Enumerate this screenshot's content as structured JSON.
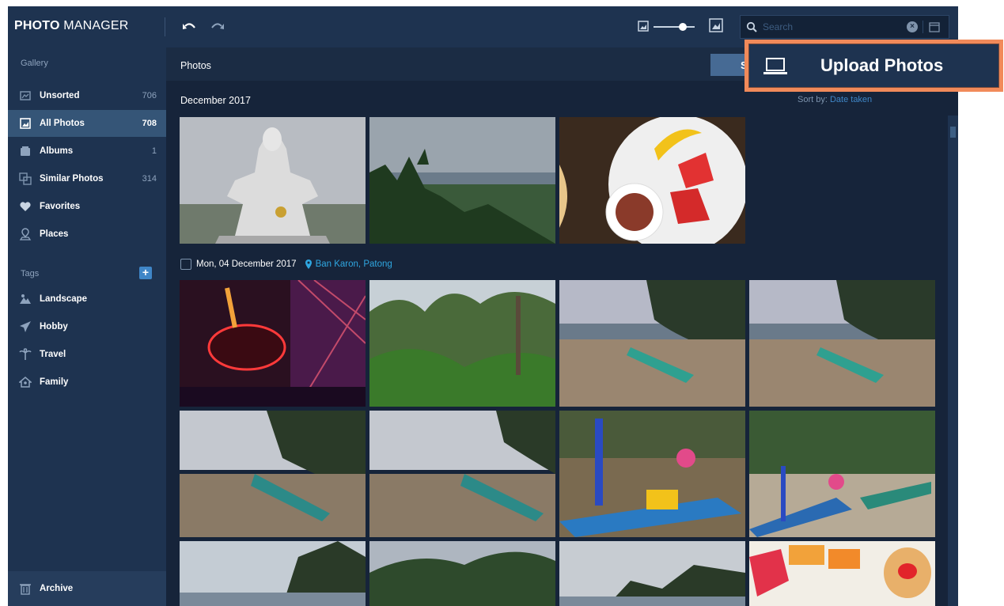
{
  "app": {
    "brand_bold": "PHOTO",
    "brand_rest": " MANAGER"
  },
  "toolbar": {
    "zoom_level": 0.75,
    "search_placeholder": "Search"
  },
  "sidebar": {
    "gallery_title": "Gallery",
    "items": [
      {
        "label": "Unsorted",
        "count": "706",
        "icon": "unsorted-icon",
        "active": false
      },
      {
        "label": "All Photos",
        "count": "708",
        "icon": "all-photos-icon",
        "active": true
      },
      {
        "label": "Albums",
        "count": "1",
        "icon": "albums-icon",
        "active": false
      },
      {
        "label": "Similar Photos",
        "count": "314",
        "icon": "similar-photos-icon",
        "active": false
      },
      {
        "label": "Favorites",
        "count": "",
        "icon": "heart-icon",
        "active": false
      },
      {
        "label": "Places",
        "count": "",
        "icon": "map-pin-icon",
        "active": false
      }
    ],
    "tags_title": "Tags",
    "tags": [
      {
        "label": "Landscape",
        "icon": "landscape-icon"
      },
      {
        "label": "Hobby",
        "icon": "plane-icon"
      },
      {
        "label": "Travel",
        "icon": "palm-tree-icon"
      },
      {
        "label": "Family",
        "icon": "family-icon"
      }
    ],
    "archive_label": "Archive"
  },
  "content": {
    "title": "Photos",
    "hidden_button_label": "S",
    "sort_by_label": "Sort by:",
    "sort_by_value": "Date taken",
    "group_title": "December 2017",
    "day_label": "Mon, 04 December 2017",
    "location": "Ban Karon, Patong"
  },
  "callout": {
    "upload_label": "Upload Photos"
  },
  "colors": {
    "accent": "#3f86c7",
    "callout_border": "#f18a5a",
    "location": "#2fa6e0"
  }
}
